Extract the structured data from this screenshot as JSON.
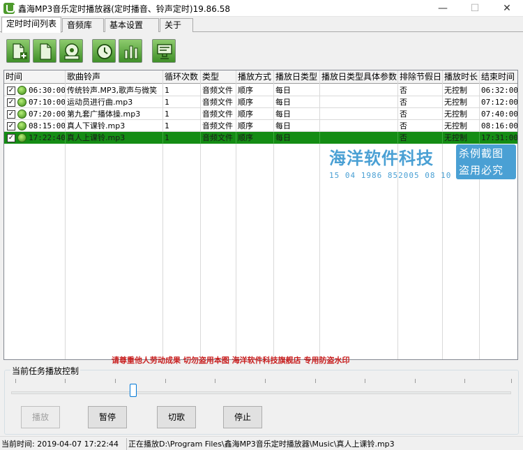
{
  "window": {
    "title": "鑫海MP3音乐定时播放器(定时播音、铃声定时)19.86.58",
    "min_glyph": "—",
    "max_glyph": "☐",
    "close_glyph": "✕"
  },
  "tabs": [
    "定时时间列表",
    "音频库",
    "基本设置",
    "关于"
  ],
  "active_tab": 0,
  "toolbar": {
    "icons": [
      "add-file-icon",
      "file-icon",
      "disk-drive-icon",
      "clock-icon",
      "bar-chart-icon",
      "monitor-icon"
    ]
  },
  "table": {
    "columns": [
      "时间",
      "歌曲铃声",
      "循环次数",
      "类型",
      "播放方式",
      "播放日类型",
      "播放日类型具体参数",
      "排除节假日",
      "播放时长",
      "结束时间"
    ],
    "rows": [
      {
        "checked": true,
        "time": "06:30:00",
        "song": "传统铃声.MP3,歌声与微笑",
        "loop": "1",
        "type": "音频文件",
        "mode": "顺序",
        "day_type": "每日",
        "params": "",
        "holiday": "否",
        "duration": "无控制",
        "end": "06:32:00"
      },
      {
        "checked": true,
        "time": "07:10:00",
        "song": "运动员进行曲.mp3",
        "loop": "1",
        "type": "音频文件",
        "mode": "顺序",
        "day_type": "每日",
        "params": "",
        "holiday": "否",
        "duration": "无控制",
        "end": "07:12:00"
      },
      {
        "checked": true,
        "time": "07:20:00",
        "song": "第九套广播体操.mp3",
        "loop": "1",
        "type": "音频文件",
        "mode": "顺序",
        "day_type": "每日",
        "params": "",
        "holiday": "否",
        "duration": "无控制",
        "end": "07:40:00"
      },
      {
        "checked": true,
        "time": "08:15:00",
        "song": "真人下课铃.mp3",
        "loop": "1",
        "type": "音频文件",
        "mode": "顺序",
        "day_type": "每日",
        "params": "",
        "holiday": "否",
        "duration": "无控制",
        "end": "08:16:00"
      },
      {
        "checked": true,
        "time": "17:22:40",
        "song": "真人上课铃.mp3",
        "loop": "1",
        "type": "音频文件",
        "mode": "顺序",
        "day_type": "每日",
        "params": "",
        "holiday": "否",
        "duration": "无控制",
        "end": "17:31:00",
        "selected": true
      }
    ]
  },
  "watermark": {
    "brand": "海洋软件科技",
    "code": "15 04 1986 852005 08 10",
    "stamp_line1": "杀例截图",
    "stamp_line2": "盗用必究"
  },
  "notice": "请尊重他人劳动成果   切勿盗用本图   海洋软件科技旗舰店   专用防盗水印",
  "control": {
    "group_title": "当前任务播放控制",
    "play": "播放",
    "pause": "暂停",
    "next": "切歌",
    "stop": "停止",
    "progress_fraction": 0.24
  },
  "status": {
    "time": "当前时间: 2019-04-07 17:22:44",
    "playing": "正在播放D:\\Program Files\\鑫海MP3音乐定时播放器\\Music\\真人上课铃.mp3"
  },
  "colors": {
    "selected_row": "#148c14",
    "watermark": "#4aa0d4",
    "notice": "#c81e1e",
    "toolbar_green": "#3f8f28"
  }
}
